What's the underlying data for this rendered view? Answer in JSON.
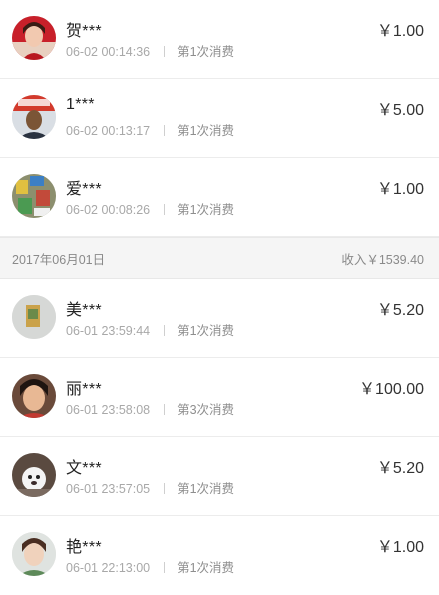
{
  "groups": [
    {
      "records": [
        {
          "name": "贺***",
          "time": "06-02 00:14:36",
          "count": "第1次消费",
          "amount": "￥1.00",
          "avatar": "avatar-woman-red"
        },
        {
          "name": "1***",
          "time": "06-02 00:13:17",
          "count": "第1次消费",
          "amount": "￥5.00",
          "avatar": "avatar-man-sign"
        },
        {
          "name": "爱***",
          "time": "06-02 00:08:26",
          "count": "第1次消费",
          "amount": "￥1.00",
          "avatar": "avatar-colorful-blocks"
        }
      ]
    },
    {
      "date": "2017年06月01日",
      "income": "收入￥1539.40",
      "records": [
        {
          "name": "美***",
          "time": "06-01 23:59:44",
          "count": "第1次消费",
          "amount": "￥5.20",
          "avatar": "avatar-grey-photo"
        },
        {
          "name": "丽***",
          "time": "06-01 23:58:08",
          "count": "第3次消费",
          "amount": "￥100.00",
          "avatar": "avatar-woman-dark"
        },
        {
          "name": "文***",
          "time": "06-01 23:57:05",
          "count": "第1次消费",
          "amount": "￥5.20",
          "avatar": "avatar-white-dog"
        },
        {
          "name": "艳***",
          "time": "06-01 22:13:00",
          "count": "第1次消费",
          "amount": "￥1.00",
          "avatar": "avatar-woman-light"
        }
      ]
    }
  ]
}
